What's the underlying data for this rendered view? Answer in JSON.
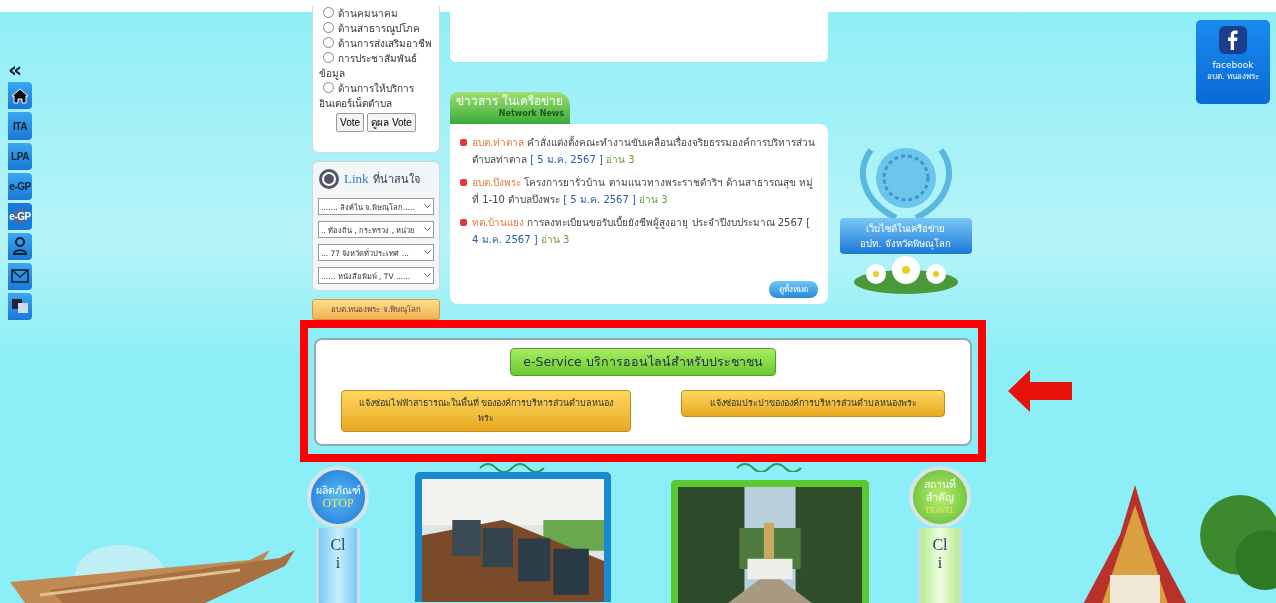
{
  "sidebar": {
    "collapse": "«",
    "items": [
      {
        "kind": "home"
      },
      {
        "kind": "text",
        "label": "ITA"
      },
      {
        "kind": "text",
        "label": "LPA"
      },
      {
        "kind": "text",
        "label": "e-GP"
      },
      {
        "kind": "globe",
        "label": "e-GP"
      },
      {
        "kind": "person"
      },
      {
        "kind": "mail"
      },
      {
        "kind": "translate"
      }
    ]
  },
  "poll": {
    "options": [
      {
        "label": "ด้านคมนาคม",
        "selected": false
      },
      {
        "label": "ด้านสาธารณูปโภค",
        "selected": false
      },
      {
        "label": "ด้านการส่งเสริมอาชีพ",
        "selected": false
      },
      {
        "label": "การประชาสัมพันธ์ข้อมูล",
        "selected": false
      },
      {
        "label": "ด้านการให้บริการอินเตอร์เน็ตตำบล",
        "selected": false
      }
    ],
    "buttons": [
      "Vote",
      "ดูผล Vote"
    ]
  },
  "links": {
    "title": "Link",
    "subtitle": "ที่น่าสนใจ",
    "selects": [
      "....... ลิงค์ใน จ.พิษณุโลก.....",
      ".. ท้องถิ่น , กระทรวง , หน่วย",
      "... 77 จังหวัดทั่วประเทศ ...",
      "...... หนังสือพิมพ์ , TV ......"
    ]
  },
  "banner": "อบต.หนองพระ จ.พิษณุโลก",
  "news": {
    "title": "ข่าวสาร ในเครือข่าย",
    "subtitle": "Network News",
    "items": [
      {
        "source": "อบต.ท่าตาล",
        "text": "คำสั่งแต่งตั้งคณะทำงานขับเคลื่อนเรื่องจริยธรรมองค์การบริหารส่วนตำบลท่าตาล",
        "date": "[ 5 ม.ค. 2567 ]",
        "reads": "อ่าน 3"
      },
      {
        "source": "อบต.บึงพระ",
        "text": "โครงการยารั่วบ้าน ตามแนวทางพระราชดำริฯ ด้านสาธารณสุข หมู่ที่ 1-10 ตำบลบึงพระ",
        "date": "[ 5 ม.ค. 2567 ]",
        "reads": "อ่าน 3"
      },
      {
        "source": "ทต.บ้านแยง",
        "text": "การลงทะเบียนขอรับเบี้ยยังชีพผู้สูงอายุ ประจำปีงบประมาณ 2567",
        "date": "[ 4 ม.ค. 2567 ]",
        "reads": "อ่าน 3"
      }
    ],
    "more": "ดูทั้งหมด"
  },
  "network": {
    "lines": [
      "เว็บไซต์ในเครือข่าย",
      "อปท. จังหวัดพิษณุโลก"
    ]
  },
  "facebook": {
    "label": "facebook",
    "page": "อบต. หนองพระ"
  },
  "eservice": {
    "title": "e-Service บริการออนไลน์สำหรับประชาชน",
    "buttons": [
      "แจ้งซ่อมไฟฟ้าสาธารณะในพื้นที่ ขององค์การบริหารส่วนตำบลหนองพระ",
      "แจ้งซ่อมประปาขององค์การบริหารส่วนตำบลหนองพระ"
    ]
  },
  "bottom": {
    "otop": {
      "lines": [
        "ผลิตภัณฑ์",
        "OTOP"
      ],
      "click": "Cli"
    },
    "travel": {
      "lines": [
        "สถานที่",
        "สำคัญ",
        "TRAVEL"
      ],
      "click": "Cli"
    }
  }
}
